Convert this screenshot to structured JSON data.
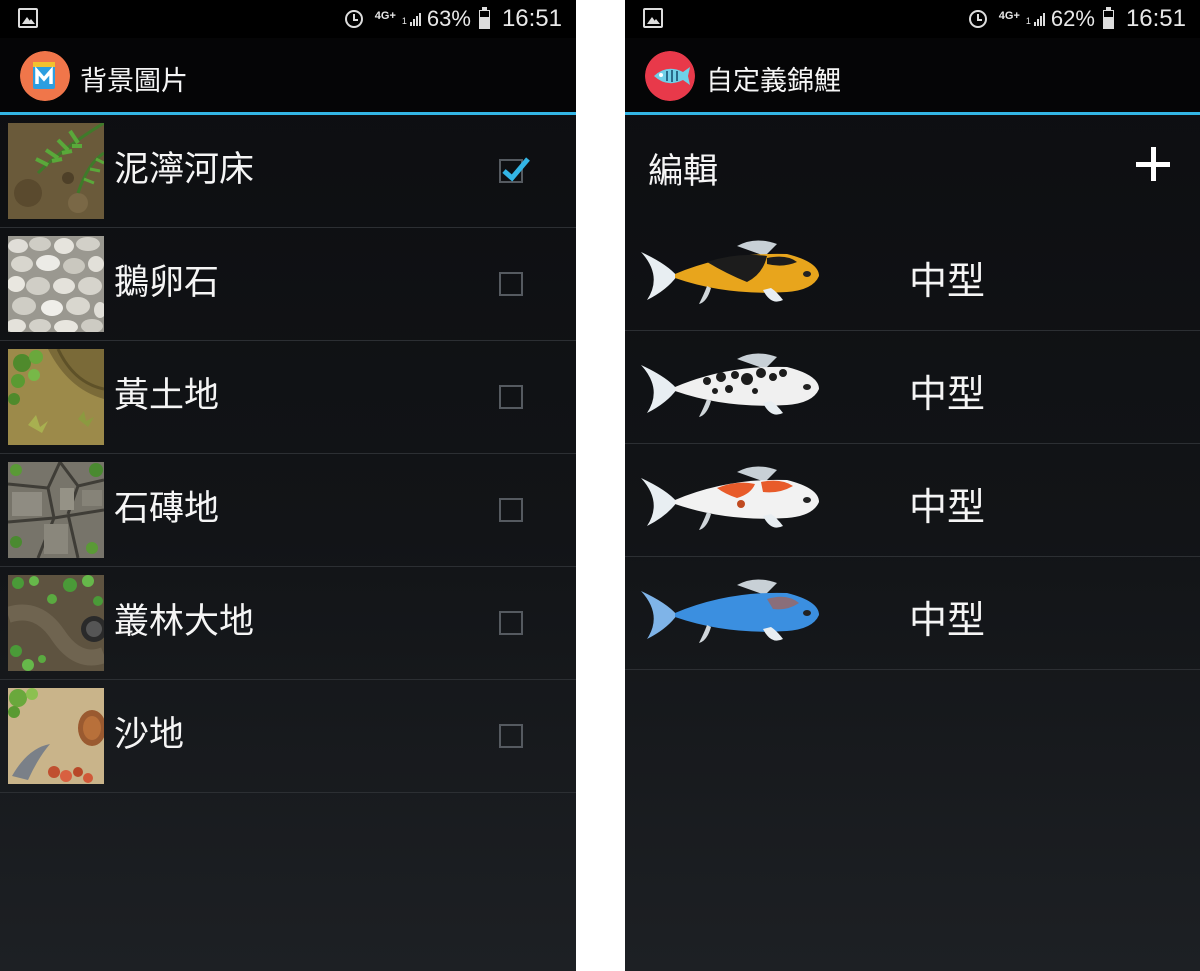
{
  "left_screen": {
    "status": {
      "battery": "63%",
      "time": "16:51",
      "network": "4G+",
      "battery_level": 0.63
    },
    "title": "背景圖片",
    "items": [
      {
        "label": "泥濘河床",
        "checked": true
      },
      {
        "label": "鵝卵石",
        "checked": false
      },
      {
        "label": "黃土地",
        "checked": false
      },
      {
        "label": "石磚地",
        "checked": false
      },
      {
        "label": "叢林大地",
        "checked": false
      },
      {
        "label": "沙地",
        "checked": false
      }
    ]
  },
  "right_screen": {
    "status": {
      "battery": "62%",
      "time": "16:51",
      "network": "4G+",
      "battery_level": 0.62
    },
    "title": "自定義錦鯉",
    "edit_label": "編輯",
    "fish": [
      {
        "label": "中型",
        "color": "#e8a51c"
      },
      {
        "label": "中型",
        "color": "#f0f0f0"
      },
      {
        "label": "中型",
        "color": "#e85b2a"
      },
      {
        "label": "中型",
        "color": "#3b8fe0"
      }
    ]
  },
  "colors": {
    "accent": "#33b5e5"
  },
  "icons": [
    "gallery-icon",
    "alarm-icon",
    "signal-icon",
    "battery-icon",
    "app-icon",
    "koi-app-icon",
    "add-icon",
    "check-icon"
  ]
}
